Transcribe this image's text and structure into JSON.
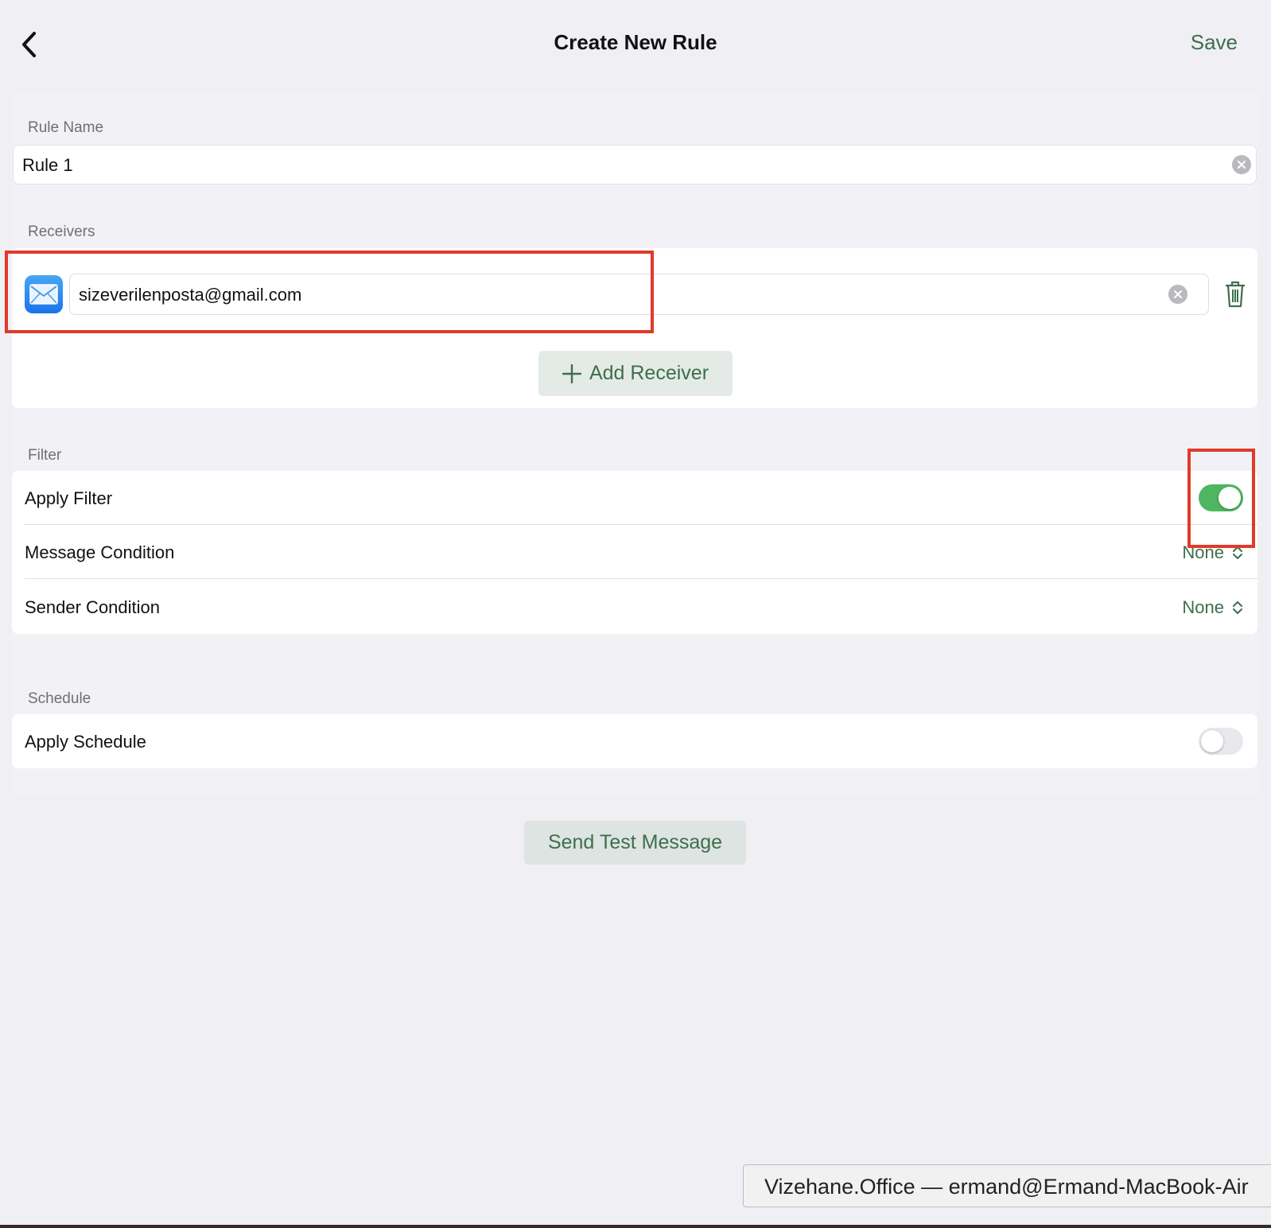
{
  "nav": {
    "title": "Create New Rule",
    "save_label": "Save"
  },
  "rule_name": {
    "label": "Rule Name",
    "value": "Rule 1"
  },
  "receivers": {
    "label": "Receivers",
    "items": [
      {
        "icon": "mail-icon",
        "email": "sizeverilenposta@gmail.com"
      }
    ],
    "add_label": "Add Receiver"
  },
  "filter": {
    "label": "Filter",
    "apply_label": "Apply Filter",
    "apply_on": true,
    "message_condition_label": "Message Condition",
    "message_condition_value": "None",
    "sender_condition_label": "Sender Condition",
    "sender_condition_value": "None"
  },
  "schedule": {
    "label": "Schedule",
    "apply_label": "Apply Schedule",
    "apply_on": false
  },
  "test_button_label": "Send Test Message",
  "tooltip_text": "Vizehane.Office — ermand@Ermand-MacBook-Air",
  "colors": {
    "accent": "#3f6e4c",
    "toggle_on": "#4eb661",
    "annotation": "#e03a2a",
    "background": "#efeff4"
  }
}
